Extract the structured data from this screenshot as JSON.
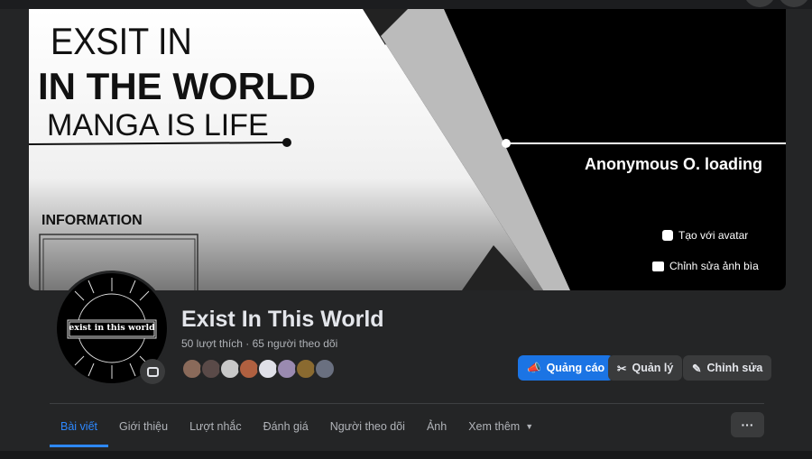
{
  "cover": {
    "line1": "EXSIT IN",
    "line2": "IN THE WORLD",
    "line3": "MANGA IS LIFE",
    "info": "INFORMATION",
    "right_text": "Anonymous O. loading",
    "create_avatar": "Tạo với avatar",
    "edit_cover": "Chỉnh sửa ảnh bìa"
  },
  "avatar": {
    "logo_text": "exist in this world"
  },
  "page": {
    "title": "Exist In This World",
    "stats": "50 lượt thích · 65 người theo dõi"
  },
  "friends": [
    "#8a6a5a",
    "#5a4a48",
    "#c8c8c8",
    "#b06040",
    "#e0e0e8",
    "#9a8ab0",
    "#8a6a30",
    "#6a7080"
  ],
  "actions": {
    "ads": "Quảng cáo",
    "manage": "Quản lý",
    "edit": "Chỉnh sửa"
  },
  "tabs": [
    "Bài viết",
    "Giới thiệu",
    "Lượt nhắc",
    "Đánh giá",
    "Người theo dõi",
    "Ảnh",
    "Xem thêm"
  ],
  "colors": {
    "accent": "#1b74e4",
    "bg": "#242526"
  }
}
